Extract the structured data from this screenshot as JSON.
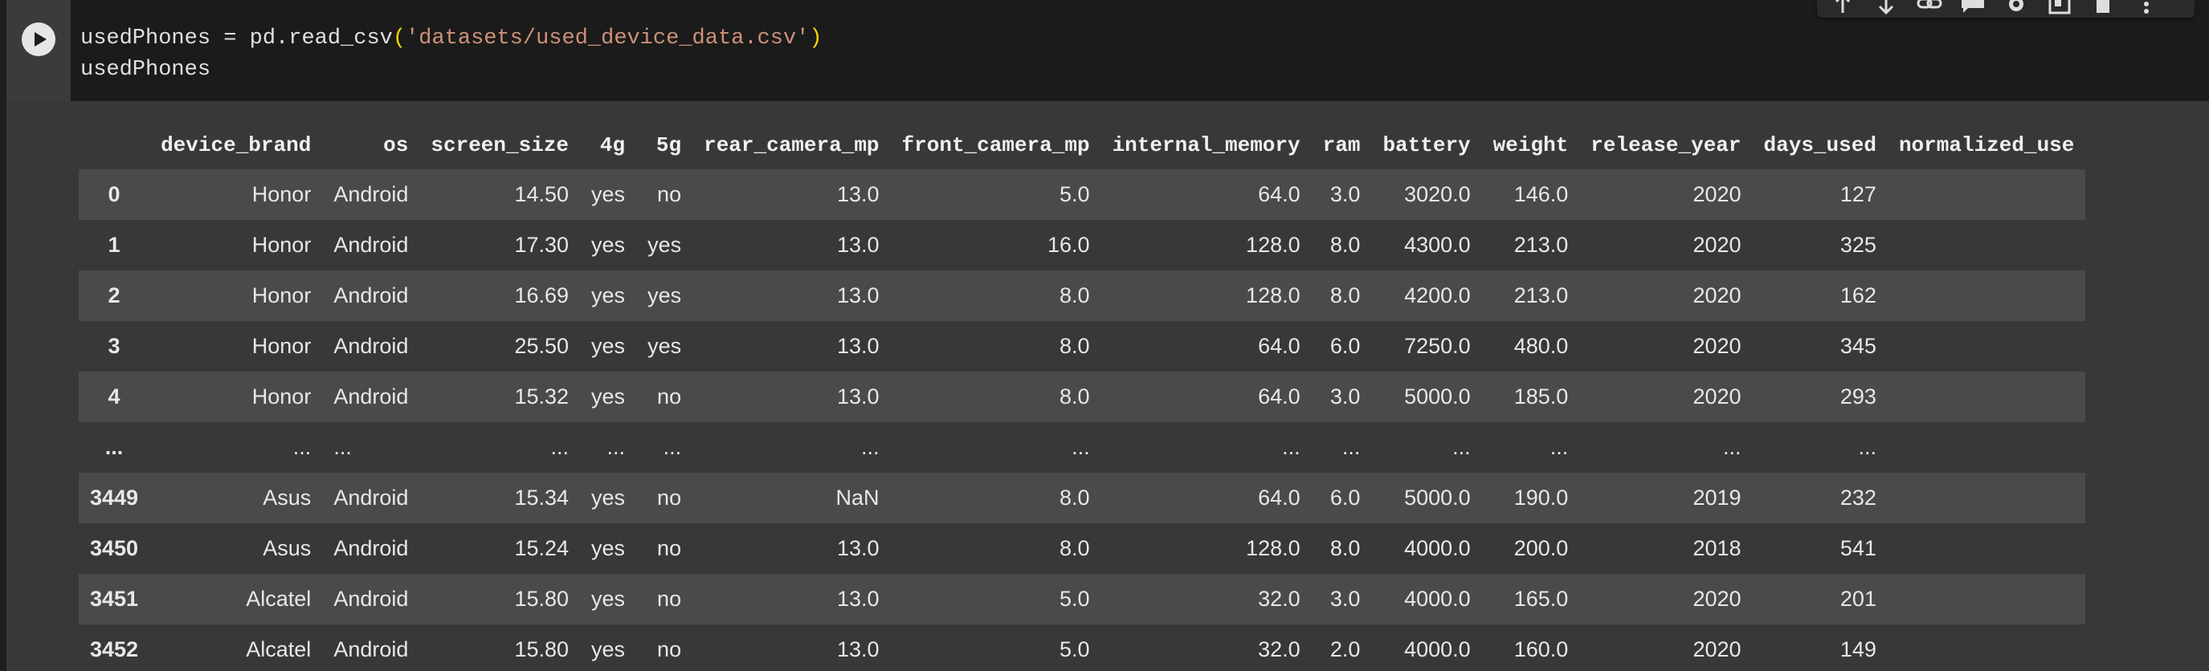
{
  "code": {
    "line1_prefix": "usedPhones = pd.read_csv",
    "line1_open": "(",
    "line1_string": "'datasets/used_device_data.csv'",
    "line1_close": ")",
    "line2": "usedPhones"
  },
  "toolbar": {
    "icons": [
      "move-up-icon",
      "move-down-icon",
      "link-icon",
      "comment-icon",
      "settings-icon",
      "mirror-cell-icon",
      "delete-icon",
      "more-icon"
    ]
  },
  "table": {
    "columns": [
      "",
      "device_brand",
      "os",
      "screen_size",
      "4g",
      "5g",
      "rear_camera_mp",
      "front_camera_mp",
      "internal_memory",
      "ram",
      "battery",
      "weight",
      "release_year",
      "days_used",
      "normalized_use"
    ],
    "rows": [
      [
        "0",
        "Honor",
        "Android",
        "14.50",
        "yes",
        "no",
        "13.0",
        "5.0",
        "64.0",
        "3.0",
        "3020.0",
        "146.0",
        "2020",
        "127",
        ""
      ],
      [
        "1",
        "Honor",
        "Android",
        "17.30",
        "yes",
        "yes",
        "13.0",
        "16.0",
        "128.0",
        "8.0",
        "4300.0",
        "213.0",
        "2020",
        "325",
        ""
      ],
      [
        "2",
        "Honor",
        "Android",
        "16.69",
        "yes",
        "yes",
        "13.0",
        "8.0",
        "128.0",
        "8.0",
        "4200.0",
        "213.0",
        "2020",
        "162",
        ""
      ],
      [
        "3",
        "Honor",
        "Android",
        "25.50",
        "yes",
        "yes",
        "13.0",
        "8.0",
        "64.0",
        "6.0",
        "7250.0",
        "480.0",
        "2020",
        "345",
        ""
      ],
      [
        "4",
        "Honor",
        "Android",
        "15.32",
        "yes",
        "no",
        "13.0",
        "8.0",
        "64.0",
        "3.0",
        "5000.0",
        "185.0",
        "2020",
        "293",
        ""
      ],
      [
        "...",
        "...",
        "...",
        "...",
        "...",
        "...",
        "...",
        "...",
        "...",
        "...",
        "...",
        "...",
        "...",
        "...",
        ""
      ],
      [
        "3449",
        "Asus",
        "Android",
        "15.34",
        "yes",
        "no",
        "NaN",
        "8.0",
        "64.0",
        "6.0",
        "5000.0",
        "190.0",
        "2019",
        "232",
        ""
      ],
      [
        "3450",
        "Asus",
        "Android",
        "15.24",
        "yes",
        "no",
        "13.0",
        "8.0",
        "128.0",
        "8.0",
        "4000.0",
        "200.0",
        "2018",
        "541",
        ""
      ],
      [
        "3451",
        "Alcatel",
        "Android",
        "15.80",
        "yes",
        "no",
        "13.0",
        "5.0",
        "32.0",
        "3.0",
        "4000.0",
        "165.0",
        "2020",
        "201",
        ""
      ],
      [
        "3452",
        "Alcatel",
        "Android",
        "15.80",
        "yes",
        "no",
        "13.0",
        "5.0",
        "32.0",
        "2.0",
        "4000.0",
        "160.0",
        "2020",
        "149",
        ""
      ]
    ]
  }
}
